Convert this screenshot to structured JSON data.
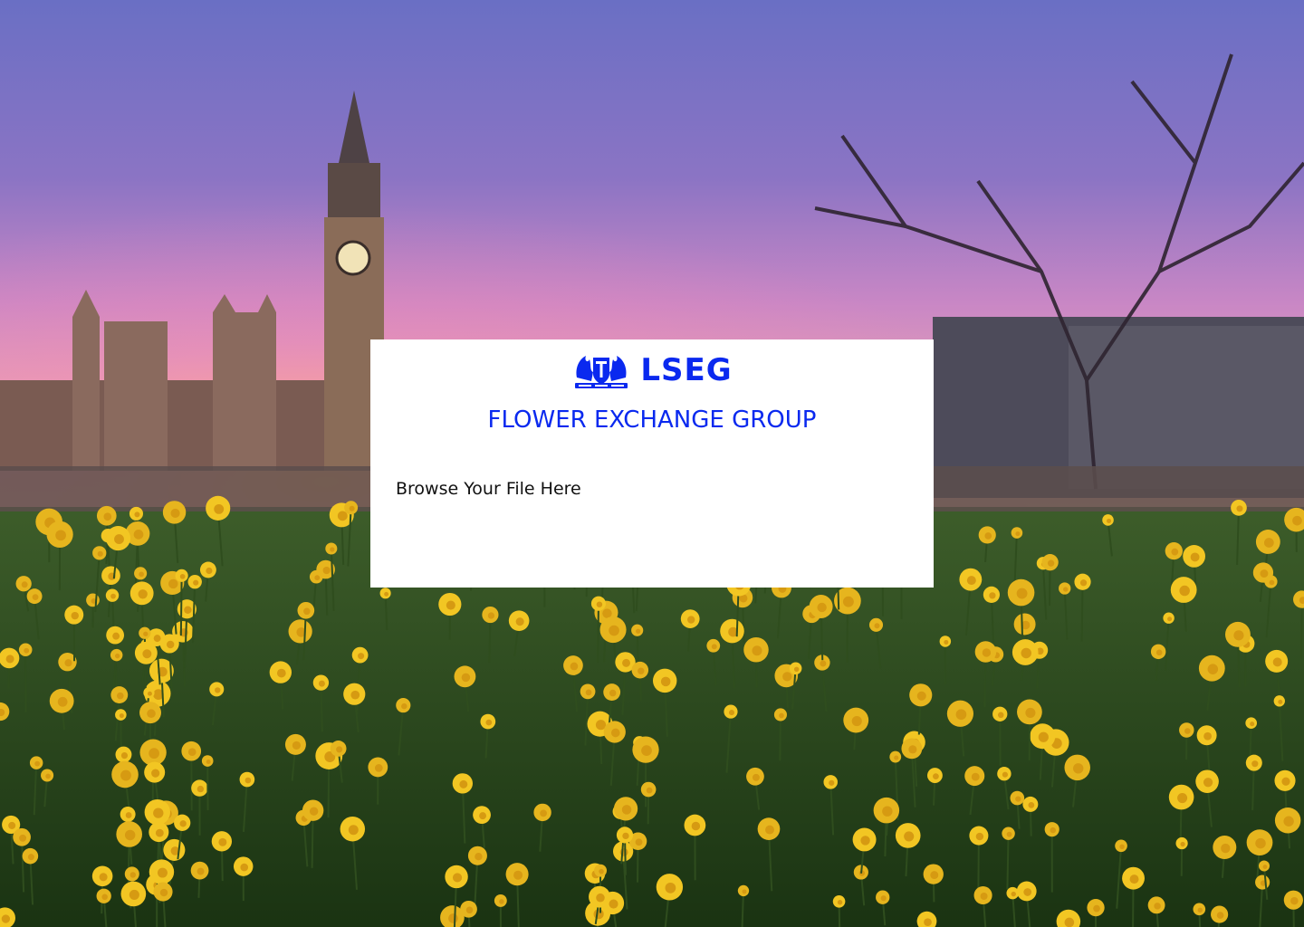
{
  "brand": {
    "logo_text": "LSEG",
    "company_name": "FLOWER EXCHANGE GROUP",
    "color": "#0a29ef"
  },
  "upload": {
    "label": "Browse Your File Here"
  },
  "background": {
    "icons": [
      "clock-tower",
      "parliament",
      "bare-tree",
      "daffodils"
    ]
  }
}
